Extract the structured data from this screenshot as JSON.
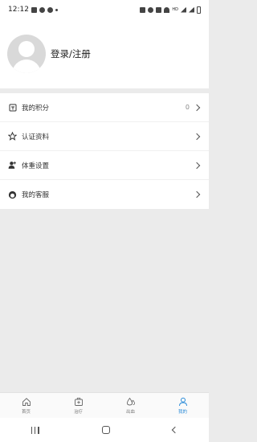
{
  "status_bar": {
    "time": "12:12",
    "network_label": "HD"
  },
  "profile": {
    "login_label": "登录/注册"
  },
  "menu": {
    "items": [
      {
        "label": "我的积分",
        "value": "0",
        "icon": "points-icon"
      },
      {
        "label": "认证资料",
        "icon": "star-icon"
      },
      {
        "label": "体重设置",
        "icon": "person-plus-icon"
      },
      {
        "label": "我的客服",
        "icon": "customer-service-icon"
      }
    ]
  },
  "tabbar": {
    "items": [
      {
        "label": "首页",
        "icon": "home-icon",
        "active": false
      },
      {
        "label": "治疗",
        "icon": "medical-kit-icon",
        "active": false
      },
      {
        "label": "出血",
        "icon": "drops-icon",
        "active": false
      },
      {
        "label": "我的",
        "icon": "user-icon",
        "active": true
      }
    ],
    "active_color": "#2a8bd8"
  }
}
